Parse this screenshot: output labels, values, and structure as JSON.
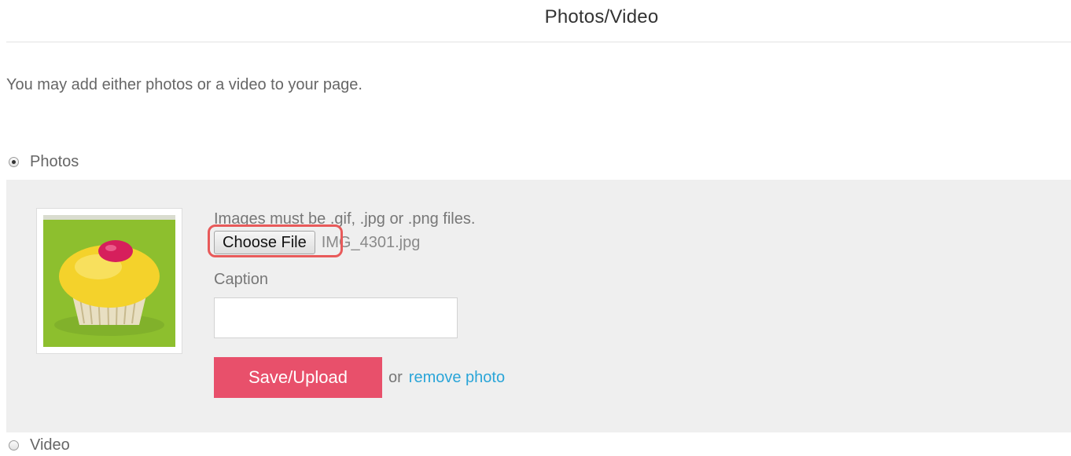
{
  "header": {
    "title": "Photos/Video"
  },
  "intro": {
    "text": "You may add either photos or a video to your page."
  },
  "media_type": {
    "photos_label": "Photos",
    "video_label": "Video",
    "selected": "Photos"
  },
  "upload": {
    "hint": "Images must be .gif, .jpg or .png files.",
    "choose_file_label": "Choose File",
    "file_name": "IMG_4301.jpg",
    "caption_label": "Caption",
    "caption_value": "",
    "save_label": "Save/Upload",
    "or_text": "or",
    "remove_label": "remove photo"
  },
  "colors": {
    "accent": "#e8506b",
    "link": "#2aa5d8",
    "panel": "#efefef",
    "highlight": "#e85a5a"
  },
  "thumbnail": {
    "icon": "cupcake-photo"
  }
}
